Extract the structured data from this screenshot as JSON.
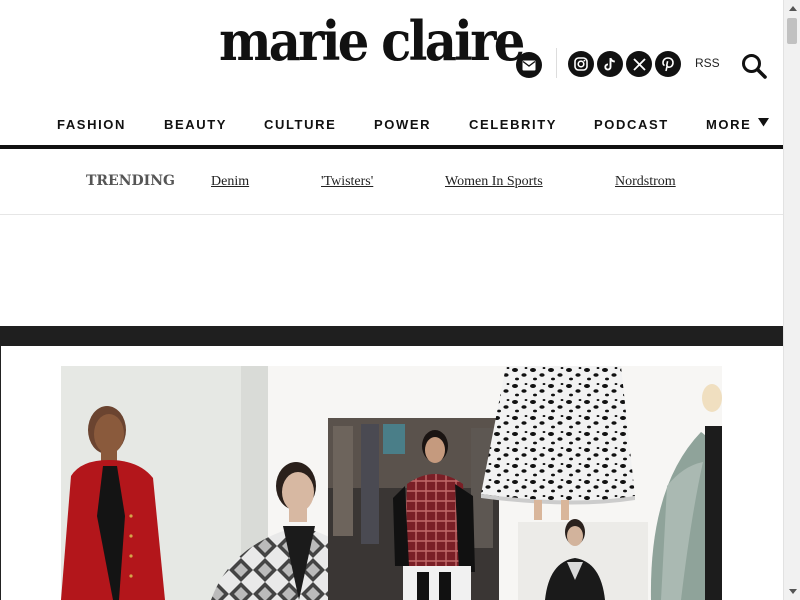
{
  "brand": {
    "logo_text": "marie claire"
  },
  "header": {
    "icons": [
      "mail-icon",
      "instagram-icon",
      "tiktok-icon",
      "x-icon",
      "pinterest-icon",
      "search-icon"
    ],
    "rss_label": "RSS"
  },
  "nav": {
    "items": [
      {
        "label": "FASHION"
      },
      {
        "label": "BEAUTY"
      },
      {
        "label": "CULTURE"
      },
      {
        "label": "POWER"
      },
      {
        "label": "CELEBRITY"
      },
      {
        "label": "PODCAST"
      },
      {
        "label": "MORE"
      }
    ]
  },
  "trending": {
    "label": "TRENDING",
    "links": [
      {
        "label": "Denim"
      },
      {
        "label": "'Twisters'"
      },
      {
        "label": "Women In Sports"
      },
      {
        "label": "Nordstrom"
      }
    ]
  },
  "colors": {
    "text": "#111111",
    "dark_band": "#1f1f1f",
    "trending_label": "#555555"
  }
}
